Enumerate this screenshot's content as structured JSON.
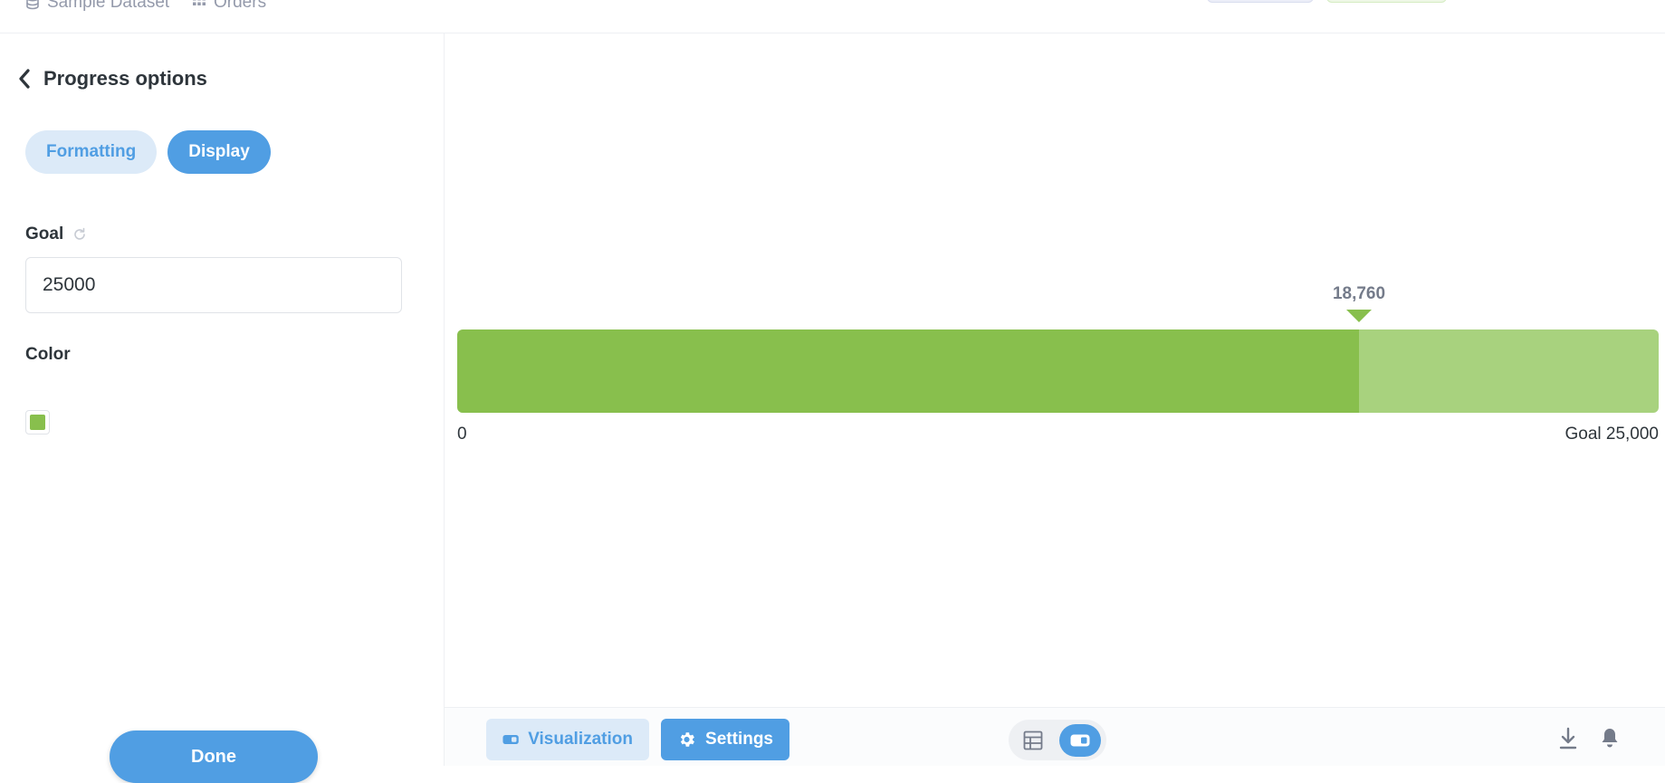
{
  "breadcrumbs": [
    {
      "label": "Sample Dataset",
      "icon": "database-icon"
    },
    {
      "label": "Orders",
      "icon": "grid-icon"
    }
  ],
  "sidebar": {
    "title": "Progress options",
    "tabs": [
      {
        "label": "Formatting",
        "active": false
      },
      {
        "label": "Display",
        "active": true
      }
    ],
    "goal": {
      "label": "Goal",
      "value": "25000"
    },
    "color": {
      "label": "Color",
      "value": "#88bf4d"
    },
    "done_label": "Done"
  },
  "progress": {
    "value": 18760,
    "goal": 25000,
    "value_label": "18,760",
    "min_label": "0",
    "goal_label": "Goal 25,000",
    "fill_color": "#88bf4d",
    "rest_color": "#a8d27e"
  },
  "footer": {
    "visualization_label": "Visualization",
    "settings_label": "Settings",
    "view_mode": "visualization"
  }
}
